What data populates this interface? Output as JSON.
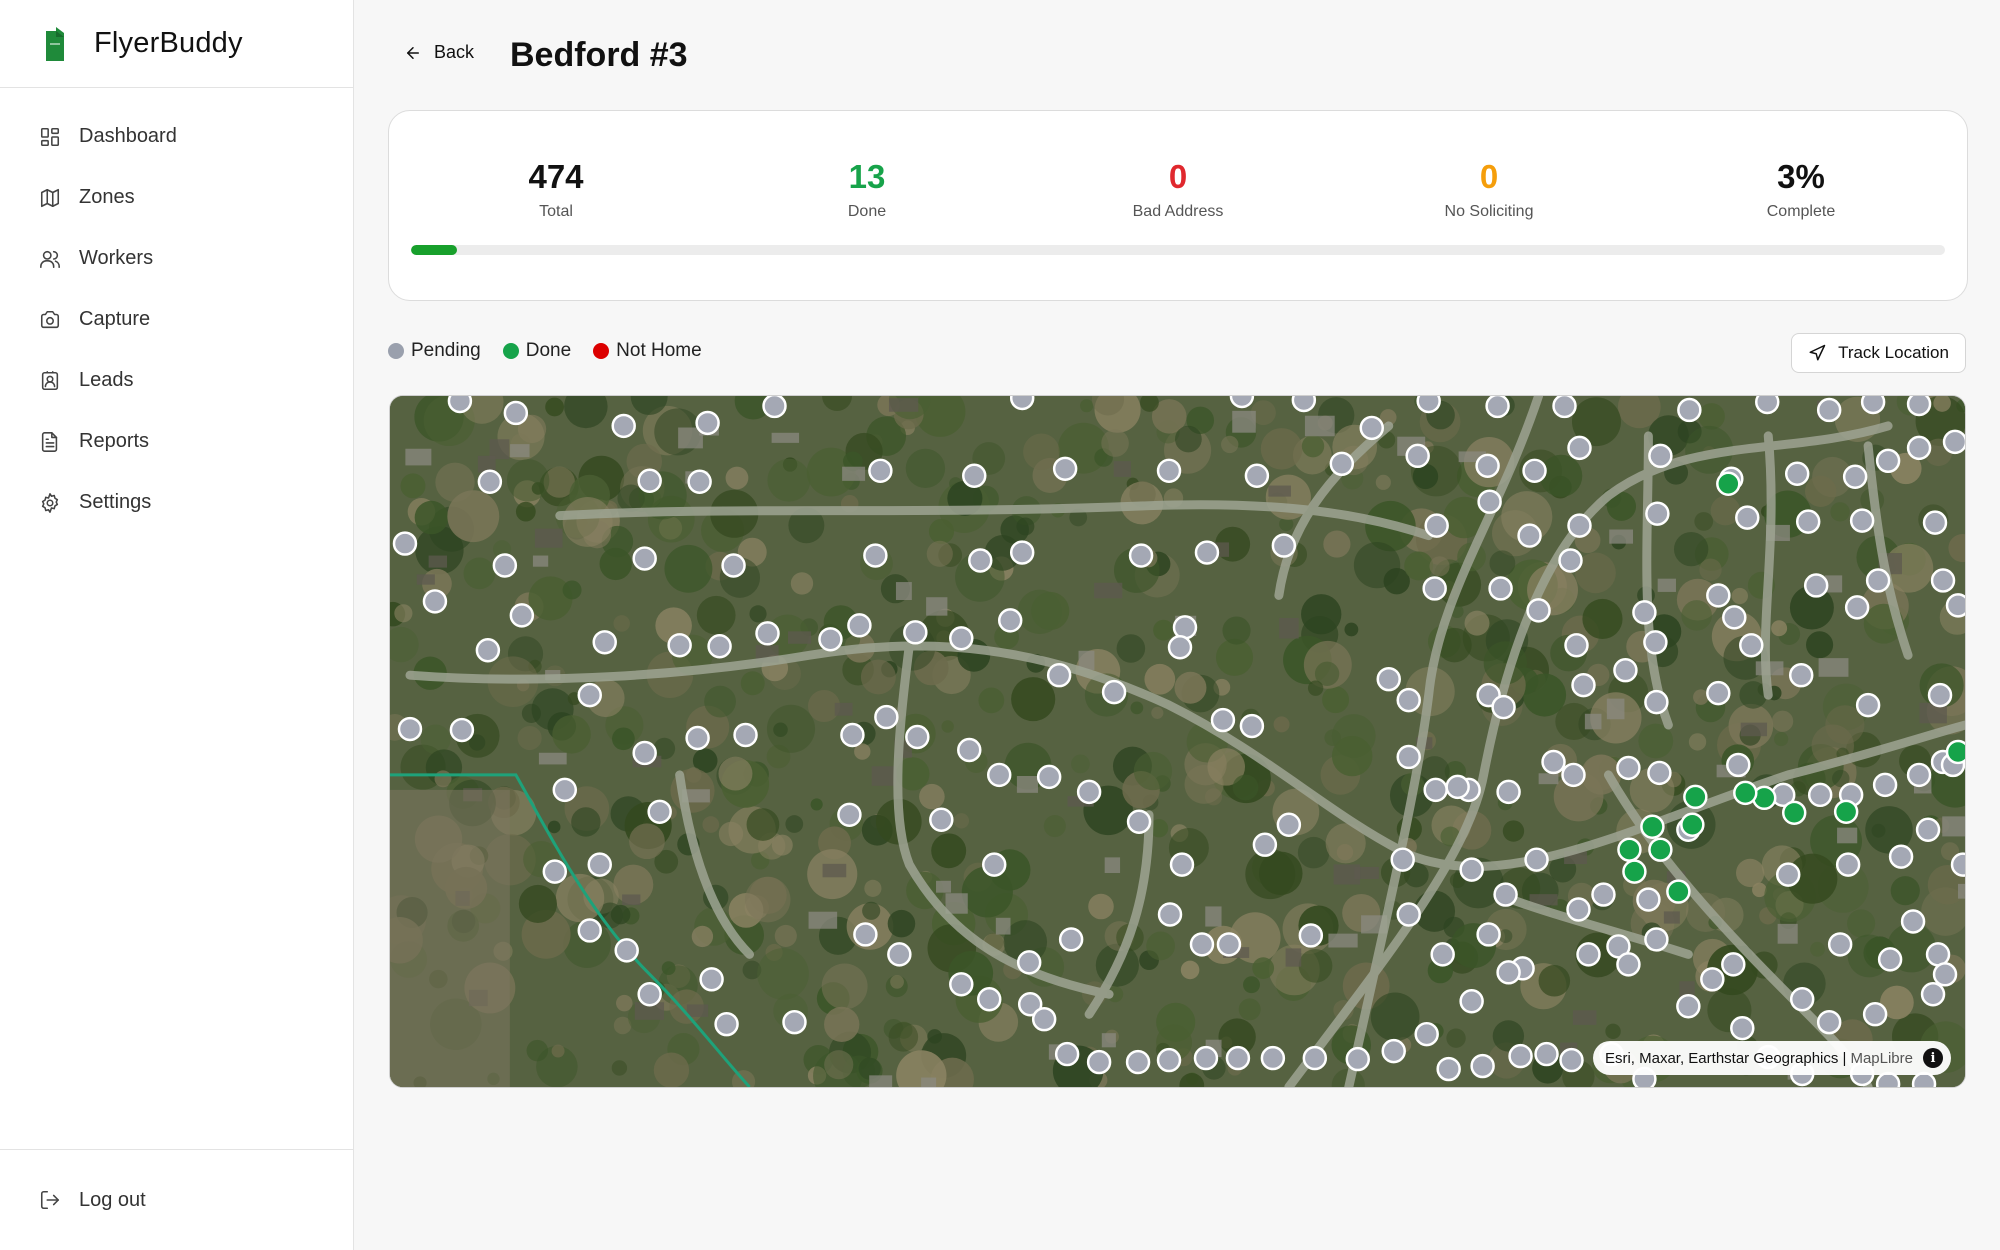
{
  "brand": {
    "name": "FlyerBuddy",
    "color": "#1f8a3a"
  },
  "nav": {
    "items": [
      {
        "label": "Dashboard",
        "icon": "dashboard-icon"
      },
      {
        "label": "Zones",
        "icon": "map-icon"
      },
      {
        "label": "Workers",
        "icon": "users-icon"
      },
      {
        "label": "Capture",
        "icon": "camera-icon"
      },
      {
        "label": "Leads",
        "icon": "contact-icon"
      },
      {
        "label": "Reports",
        "icon": "document-icon"
      },
      {
        "label": "Settings",
        "icon": "gear-icon"
      }
    ],
    "logout_label": "Log out"
  },
  "header": {
    "back_label": "Back",
    "title": "Bedford #3"
  },
  "stats": {
    "total": {
      "value": "474",
      "label": "Total",
      "color": "#111111"
    },
    "done": {
      "value": "13",
      "label": "Done",
      "color": "#17a34a"
    },
    "bad_address": {
      "value": "0",
      "label": "Bad Address",
      "color": "#e0282e"
    },
    "no_soliciting": {
      "value": "0",
      "label": "No Soliciting",
      "color": "#f59e0b"
    },
    "complete": {
      "value": "3%",
      "label": "Complete",
      "color": "#111111"
    },
    "progress_fraction": 0.03
  },
  "legend": [
    {
      "label": "Pending",
      "color": "#9aa0ad"
    },
    {
      "label": "Done",
      "color": "#16a34a"
    },
    {
      "label": "Not Home",
      "color": "#dc0000"
    }
  ],
  "track_location_label": "Track Location",
  "map": {
    "attribution": "Esri, Maxar, Earthstar Geographics |",
    "attribution_link": "MapLibre",
    "pending_color": "#a4a8b4",
    "done_color": "#16a34a"
  }
}
